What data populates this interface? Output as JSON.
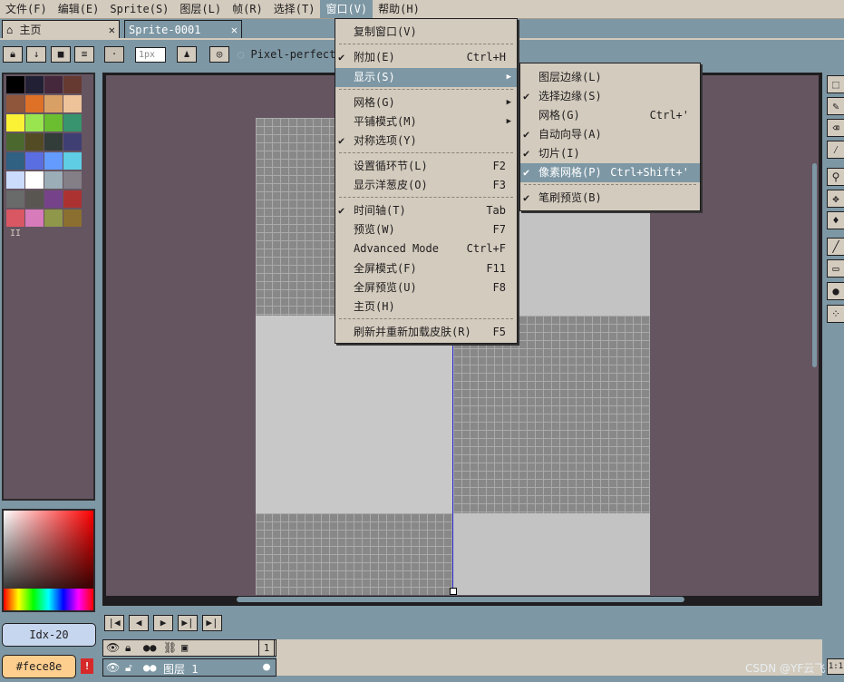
{
  "menubar": {
    "items": [
      "文件(F)",
      "编辑(E)",
      "Sprite(S)",
      "图层(L)",
      "帧(R)",
      "选择(T)",
      "窗口(V)",
      "帮助(H)"
    ]
  },
  "tabs": {
    "home": "主页",
    "sprite": "Sprite-0001"
  },
  "toolbar": {
    "brush_size": "1px",
    "pixel_perfect": "Pixel-perfect"
  },
  "window_menu": {
    "items": [
      {
        "label": "复制窗口(V)",
        "shortcut": "",
        "checked": false,
        "submenu": false
      },
      {
        "label": "附加(E)",
        "shortcut": "Ctrl+H",
        "checked": true,
        "submenu": false
      },
      {
        "label": "显示(S)",
        "shortcut": "",
        "checked": false,
        "submenu": true
      },
      {
        "label": "网格(G)",
        "shortcut": "",
        "checked": false,
        "submenu": true
      },
      {
        "label": "平铺模式(M)",
        "shortcut": "",
        "checked": false,
        "submenu": true
      },
      {
        "label": "对称选项(Y)",
        "shortcut": "",
        "checked": true,
        "submenu": false
      },
      {
        "label": "设置循环节(L)",
        "shortcut": "F2",
        "checked": false,
        "submenu": false
      },
      {
        "label": "显示洋葱皮(O)",
        "shortcut": "F3",
        "checked": false,
        "submenu": false
      },
      {
        "label": "时间轴(T)",
        "shortcut": "Tab",
        "checked": true,
        "submenu": false
      },
      {
        "label": "预览(W)",
        "shortcut": "F7",
        "checked": false,
        "submenu": false
      },
      {
        "label": "Advanced Mode",
        "shortcut": "Ctrl+F",
        "checked": false,
        "submenu": false
      },
      {
        "label": "全屏模式(F)",
        "shortcut": "F11",
        "checked": false,
        "submenu": false
      },
      {
        "label": "全屏预览(U)",
        "shortcut": "F8",
        "checked": false,
        "submenu": false
      },
      {
        "label": "主页(H)",
        "shortcut": "",
        "checked": false,
        "submenu": false
      },
      {
        "label": "刷新并重新加载皮肤(R)",
        "shortcut": "F5",
        "checked": false,
        "submenu": false
      }
    ]
  },
  "show_submenu": {
    "items": [
      {
        "label": "图层边缘(L)",
        "shortcut": "",
        "checked": false
      },
      {
        "label": "选择边缘(S)",
        "shortcut": "",
        "checked": true
      },
      {
        "label": "网格(G)",
        "shortcut": "Ctrl+'",
        "checked": false
      },
      {
        "label": "自动向导(A)",
        "shortcut": "",
        "checked": true
      },
      {
        "label": "切片(I)",
        "shortcut": "",
        "checked": true
      },
      {
        "label": "像素网格(P)",
        "shortcut": "Ctrl+Shift+'",
        "checked": true
      },
      {
        "label": "笔刷预览(B)",
        "shortcut": "",
        "checked": true
      }
    ]
  },
  "palette": {
    "colors": [
      "#000000",
      "#222034",
      "#45283c",
      "#663931",
      "#8f563b",
      "#df7126",
      "#d9a066",
      "#eec39a",
      "#fbf236",
      "#99e550",
      "#6abe30",
      "#37946e",
      "#4b692f",
      "#524b24",
      "#323c39",
      "#3f3f74",
      "#306082",
      "#5b6ee1",
      "#639bff",
      "#5fcde4",
      "#cbdbfc",
      "#ffffff",
      "#9badb7",
      "#847e87",
      "#696a6a",
      "#595652",
      "#76428a",
      "#ac3232",
      "#d95763",
      "#d77bba",
      "#8f974a",
      "#8a6f30"
    ]
  },
  "color_panel": {
    "index_label": "Idx-20",
    "hex_label": "#fece8e",
    "fg_color": "#fece8e"
  },
  "timeline": {
    "frame_number": "1",
    "layer_name": "图层 1"
  },
  "status": {
    "zoom_label": "1:1",
    "watermark": "CSDN @YF云飞"
  }
}
